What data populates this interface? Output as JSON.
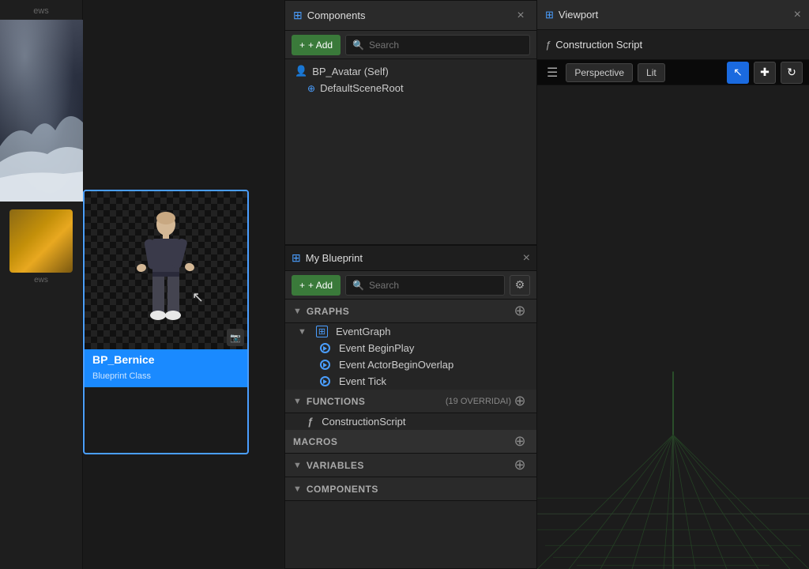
{
  "panels": {
    "components": {
      "tab_label": "Components",
      "close_icon": "×",
      "add_label": "+ Add",
      "search_placeholder": "Search",
      "tree": [
        {
          "id": "bp_avatar",
          "label": "BP_Avatar (Self)",
          "icon": "👤",
          "indent": 0
        },
        {
          "id": "default_scene_root",
          "label": "DefaultSceneRoot",
          "icon": "⊕",
          "indent": 1
        }
      ]
    },
    "viewport": {
      "tab_label": "Viewport",
      "close_icon": "×",
      "perspective_label": "Perspective",
      "lit_label": "Lit",
      "transform_icon": "↖",
      "move_icon": "⊕",
      "rotate_icon": "↻"
    },
    "construction": {
      "tab_label": "Construction Script",
      "tab_icon": "ƒ"
    },
    "my_blueprint": {
      "tab_label": "My Blueprint",
      "close_icon": "×",
      "add_label": "+ Add",
      "search_placeholder": "Search",
      "sections": {
        "graphs": {
          "label": "GRAPHS",
          "items": [
            {
              "label": "EventGraph",
              "icon": "graph",
              "children": [
                {
                  "label": "Event BeginPlay",
                  "icon": "event"
                },
                {
                  "label": "Event ActorBeginOverlap",
                  "icon": "event"
                },
                {
                  "label": "Event Tick",
                  "icon": "event"
                }
              ]
            }
          ]
        },
        "functions": {
          "label": "FUNCTIONS",
          "override_count": "19 OVERRIDAI",
          "items": [
            {
              "label": "ConstructionScript",
              "icon": "func"
            }
          ]
        },
        "macros": {
          "label": "MACROS"
        },
        "variables": {
          "label": "VARIABLES"
        },
        "components": {
          "label": "Components"
        }
      }
    }
  },
  "asset": {
    "name": "BP_Bernice",
    "type": "Blueprint Class"
  },
  "sidebar": {
    "label": "ews"
  },
  "icons": {
    "search": "🔍",
    "add": "+",
    "close": "×",
    "expand": "▼",
    "collapse": "▶",
    "gear": "⚙",
    "plus_circle": "⊕",
    "graph_icon": "⊞",
    "func_icon": "ƒ"
  }
}
